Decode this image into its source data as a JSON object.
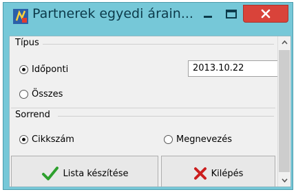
{
  "window": {
    "title": "Partnerek egyedi árain...",
    "colors": {
      "frame": "#76c8d8",
      "close": "#d9433a",
      "client": "#f0f0f0"
    }
  },
  "titlebar_buttons": {
    "minimize": "minimize-icon",
    "maximize": "maximize-icon",
    "close": "close-icon"
  },
  "tipus": {
    "label": "Típus",
    "options": [
      {
        "label": "Időponti",
        "selected": true
      },
      {
        "label": "Összes",
        "selected": false
      }
    ],
    "date_value": "2013.10.22"
  },
  "sorrend": {
    "label": "Sorrend",
    "options": [
      {
        "label": "Cikkszám",
        "selected": true
      },
      {
        "label": "Megnevezés",
        "selected": false
      }
    ]
  },
  "actions": {
    "list_label": "Lista készítése",
    "list_icon": "checkmark-icon",
    "exit_label": "Kilépés",
    "exit_icon": "x-icon"
  }
}
